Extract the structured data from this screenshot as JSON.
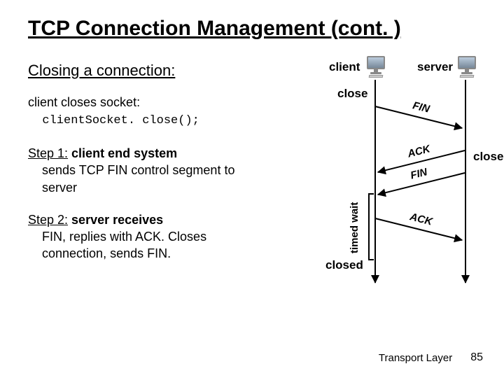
{
  "title": "TCP Connection Management (cont. )",
  "left": {
    "closing_heading": "Closing a connection:",
    "p1_line1": "client closes socket:",
    "p1_code": "clientSocket. close();",
    "step1_lead": "Step 1:",
    "step1_bold": " client end system",
    "step1_rest": "sends TCP FIN control segment to server",
    "step2_lead": "Step 2:",
    "step2_bold": " server receives",
    "step2_rest": "FIN, replies with ACK. Closes connection, sends FIN."
  },
  "diagram": {
    "client_label": "client",
    "server_label": "server",
    "close_left": "close",
    "close_right": "close",
    "closed": "closed",
    "timed_wait": "timed wait",
    "msg_fin1": "FIN",
    "msg_ack1": "ACK",
    "msg_fin2": "FIN",
    "msg_ack2": "ACK"
  },
  "footer": {
    "chapter": "Transport Layer",
    "page": "85"
  }
}
